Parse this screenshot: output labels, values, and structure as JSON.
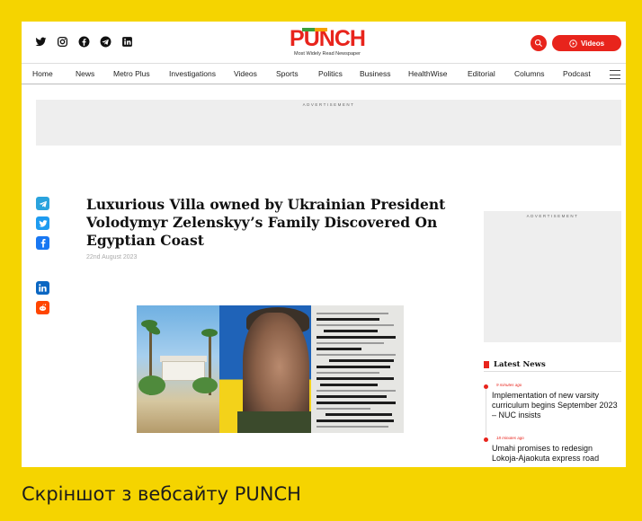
{
  "header": {
    "logo": "PUNCH",
    "tagline": "Most Widely Read Newspaper",
    "videos_label": "Videos",
    "social_icons": [
      "twitter-icon",
      "instagram-icon",
      "facebook-icon",
      "telegram-icon",
      "linkedin-icon"
    ]
  },
  "nav": {
    "items": [
      "Home",
      "News",
      "Metro Plus",
      "Investigations",
      "Videos",
      "Sports",
      "Politics",
      "Business",
      "HealthWise",
      "Editorial",
      "Columns",
      "Podcast"
    ]
  },
  "ads": {
    "top_label": "ADVERTISEMENT",
    "side_label": "ADVERTISEMENT"
  },
  "article": {
    "title": "Luxurious Villa owned by Ukrainian President Volodymyr Zelenskyy’s Family Discovered On Egyptian Coast",
    "date": "22nd August 2023"
  },
  "share_icons": [
    "telegram-icon",
    "twitter-icon",
    "facebook-icon",
    "linkedin-icon",
    "reddit-icon"
  ],
  "latest_news": {
    "heading": "Latest News",
    "items": [
      {
        "time": "9 minutes ago",
        "headline": "Implementation of new varsity curriculum begins September 2023 – NUC insists"
      },
      {
        "time": "18 minutes ago",
        "headline": "Umahi promises to redesign Lokoja-Ajaokuta express road"
      }
    ]
  },
  "caption": "Скріншот з вебсайту PUNCH",
  "colors": {
    "frame": "#f5d400",
    "brand_red": "#e8241c"
  }
}
